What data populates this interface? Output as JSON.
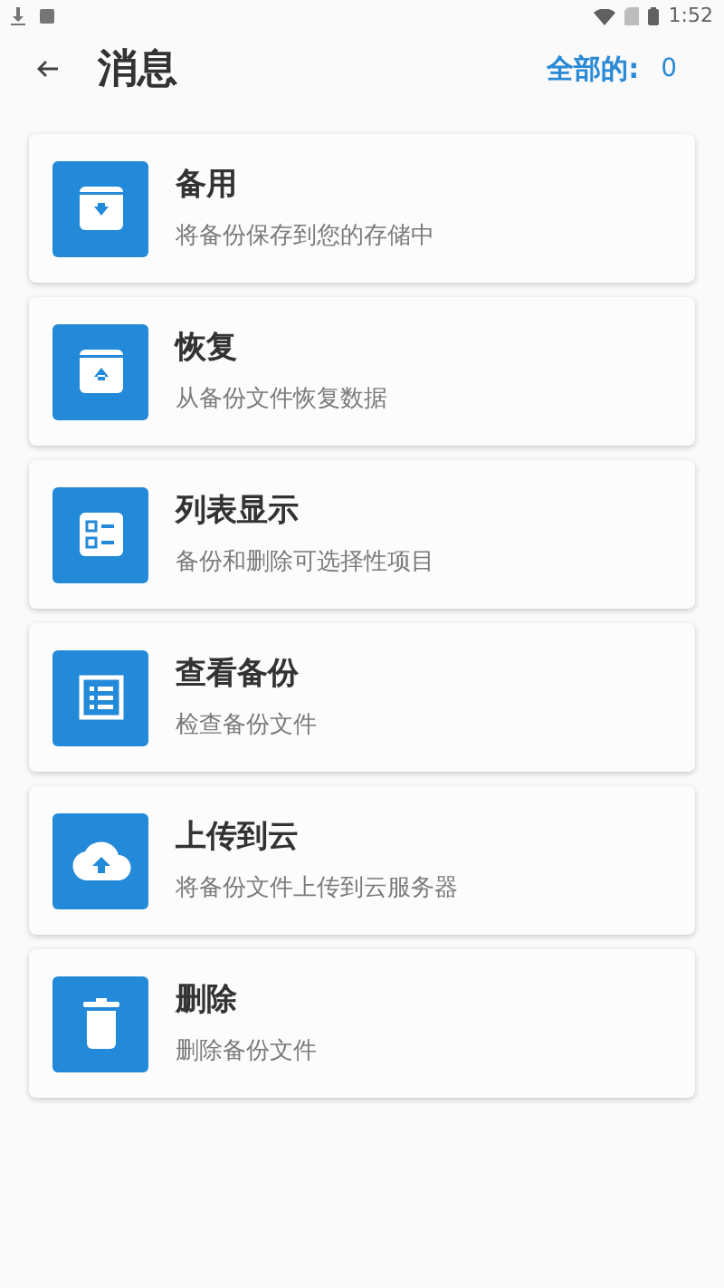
{
  "status_bar": {
    "time": "1:52"
  },
  "header": {
    "title": "消息",
    "count_label": "全部的:",
    "count": "0"
  },
  "items": [
    {
      "kind": "backup",
      "title": "备用",
      "subtitle": "将备份保存到您的存储中"
    },
    {
      "kind": "restore",
      "title": "恢复",
      "subtitle": "从备份文件恢复数据"
    },
    {
      "kind": "select",
      "title": "列表显示",
      "subtitle": "备份和删除可选择性项目"
    },
    {
      "kind": "view",
      "title": "查看备份",
      "subtitle": "检查备份文件"
    },
    {
      "kind": "cloud",
      "title": "上传到云",
      "subtitle": "将备份文件上传到云服务器"
    },
    {
      "kind": "delete",
      "title": "删除",
      "subtitle": "删除备份文件"
    }
  ]
}
